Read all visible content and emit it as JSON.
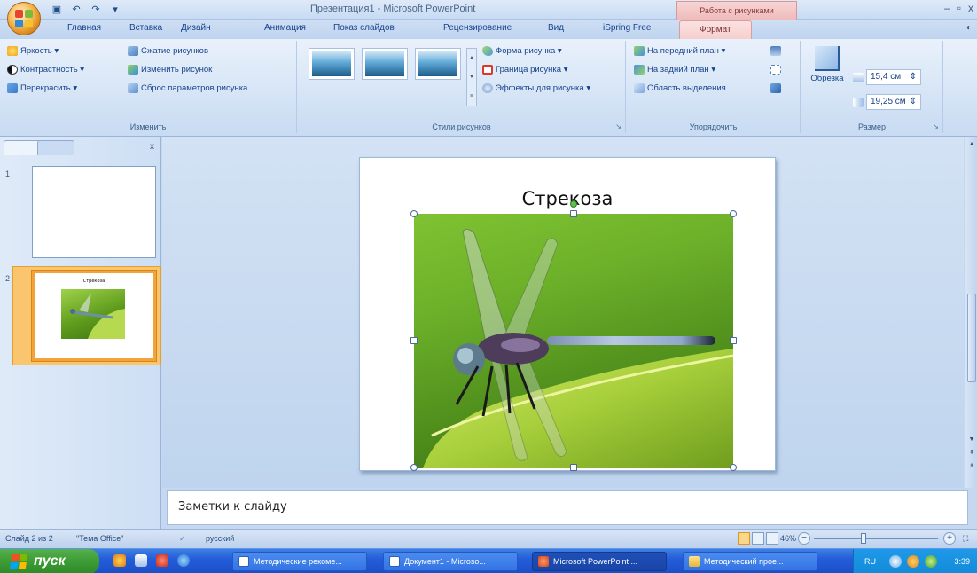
{
  "titlebar": {
    "title": "Презентация1 - Microsoft PowerPoint",
    "context_tab": "Работа с рисунками",
    "minimize": "–",
    "restore": "▫",
    "close": "x"
  },
  "ribbon_tabs": [
    "Главная",
    "Вставка",
    "Дизайн",
    "Анимация",
    "Показ слайдов",
    "Рецензирование",
    "Вид",
    "iSpring Free",
    "Формат"
  ],
  "active_tab": "Формат",
  "help_icon": "help-icon",
  "groups": {
    "adjust": {
      "label": "Изменить",
      "brightness": "Яркость ▾",
      "contrast": "Контрастность ▾",
      "recolor": "Перекрасить ▾",
      "compress": "Сжатие рисунков",
      "change": "Изменить рисунок",
      "reset": "Сброс параметров рисунка"
    },
    "styles": {
      "label": "Стили рисунков",
      "shape": "Форма рисунка ▾",
      "border": "Граница рисунка ▾",
      "effects": "Эффекты для рисунка ▾"
    },
    "arrange": {
      "label": "Упорядочить",
      "front": "На передний план ▾",
      "back": "На задний план ▾",
      "selection": "Область выделения"
    },
    "size": {
      "label": "Размер",
      "crop": "Обрезка",
      "height": "15,4 см",
      "width": "19,25 см"
    }
  },
  "slides": [
    {
      "number": "1",
      "title": ""
    },
    {
      "number": "2",
      "title": "Стрекоза"
    }
  ],
  "slide": {
    "title": "Стрекоза"
  },
  "notes": {
    "placeholder": "Заметки к слайду"
  },
  "status": {
    "slide_counter": "Слайд 2 из 2",
    "theme": "\"Тема Office\"",
    "language": "русский",
    "zoom": "46%",
    "zoom_fraction": 0.4
  },
  "taskbar": {
    "start": "пуск",
    "buttons": [
      "Методические рекоме...",
      "Документ1 - Microso...",
      "Microsoft PowerPoint ...",
      "Методический прое..."
    ],
    "active_index": 2,
    "lang": "RU",
    "time": "3:39"
  },
  "colors": {
    "ribbon_bg": "#d5e4f6",
    "context_accent": "#eebbbb",
    "selection_orange": "#f2a33a",
    "taskbar_blue": "#245edb",
    "start_green": "#3c9c35"
  }
}
